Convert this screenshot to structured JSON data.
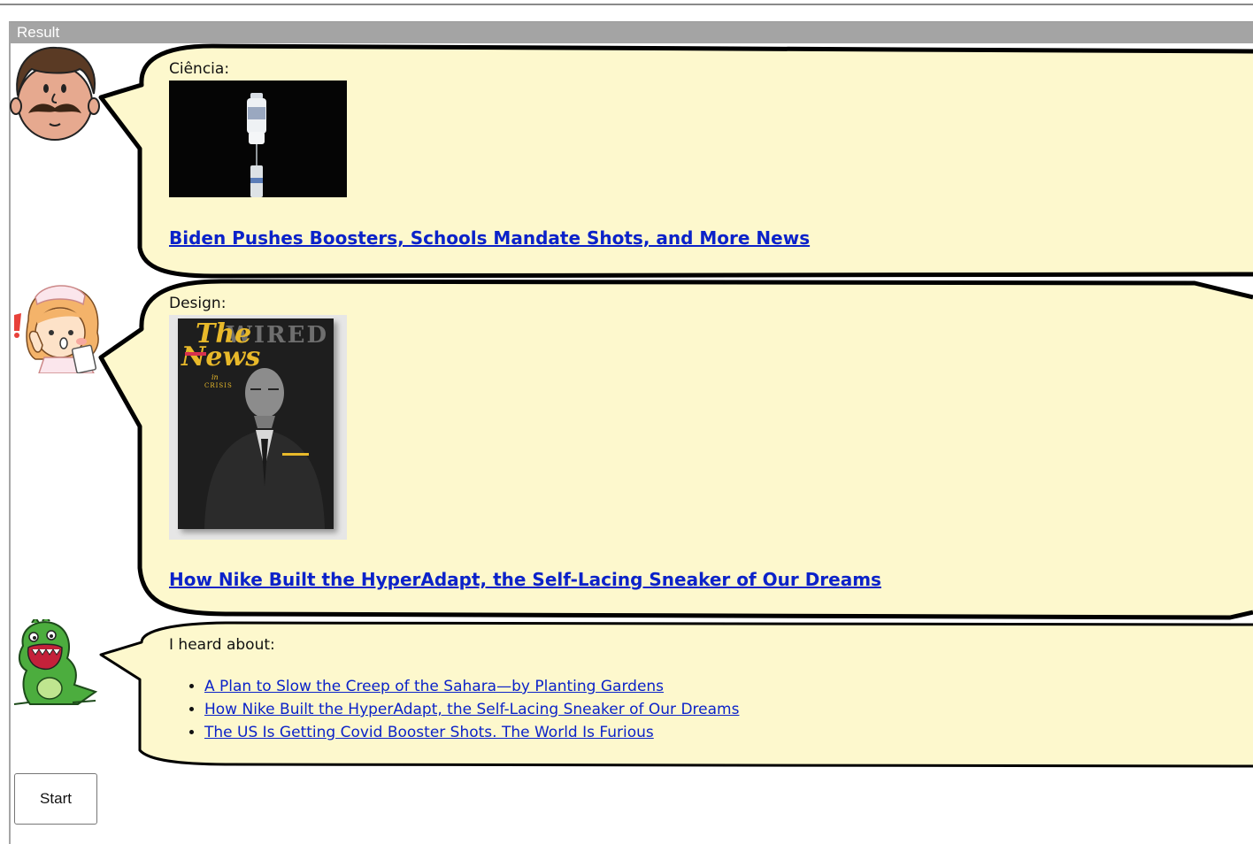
{
  "panel": {
    "title": "Result"
  },
  "messages": [
    {
      "avatar": "mustache-man-avatar",
      "label": "Ciência:",
      "headline": "Biden Pushes Boosters, Schools Mandate Shots, and More News"
    },
    {
      "avatar": "nurse-avatar",
      "label": "Design:",
      "headline": "How Nike Built the HyperAdapt, the Self-Lacing Sneaker of Our Dreams",
      "cover": {
        "masthead": "WIRED",
        "title_line1": "The",
        "title_line2": "News",
        "subtitle_in": "in",
        "subtitle_crisis": "CRISIS"
      }
    },
    {
      "avatar": "green-dinosaur-avatar",
      "label": "I heard about:",
      "items": [
        "A Plan to Slow the Creep of the Sahara—by Planting Gardens",
        "How Nike Built the HyperAdapt, the Self-Lacing Sneaker of Our Dreams",
        "The US Is Getting Covid Booster Shots. The World Is Furious"
      ]
    }
  ],
  "controls": {
    "start_label": "Start"
  },
  "colors": {
    "bubble_fill": "#fdf8cd",
    "link": "#0b22c9",
    "header": "#a4a4a4"
  }
}
